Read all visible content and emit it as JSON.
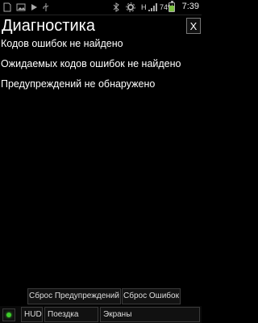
{
  "statusbar": {
    "left_icons": [
      "sim-icon",
      "image-icon",
      "play-icon",
      "usb-icon",
      "bluetooth-icon",
      "settings-icon"
    ],
    "network_type": "H",
    "battery_percent": "74%",
    "battery_level": 0.74,
    "time": "7:39"
  },
  "screen": {
    "title": "Диагностика",
    "close_label": "X",
    "messages": [
      "Кодов ошибок не найдено",
      "Ожидаемых кодов ошибок не найдено",
      "Предупреждений не обнаружено"
    ]
  },
  "actions": {
    "reset_warnings_label": "Сброс Предупреждений",
    "reset_errors_label": "Сброс Ошибок"
  },
  "bottombar": {
    "connection_status_color": "#3dcc2b",
    "hud_label": "HUD",
    "trip_label": "Поездка",
    "screens_label": "Экраны"
  }
}
